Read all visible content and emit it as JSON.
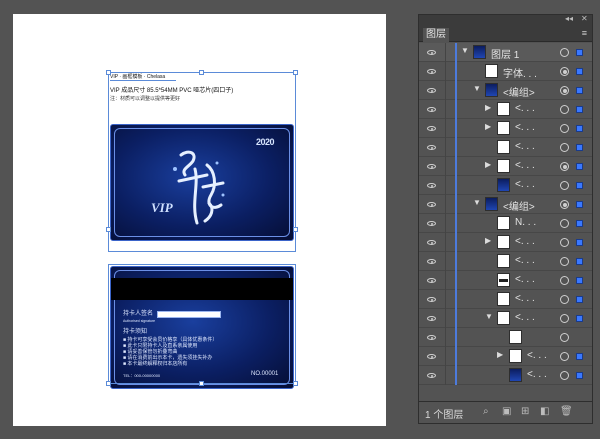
{
  "panel": {
    "tab_label": "图层",
    "collapse_glyph": "◂◂",
    "close_glyph": "✕",
    "menu_glyph": "≡",
    "layer_count": "1 个图层",
    "rows": [
      {
        "level": 0,
        "triangle": "▼",
        "name": "图层 1",
        "thumb": "layer",
        "target": "empty",
        "selected": true
      },
      {
        "level": 2,
        "triangle": "",
        "name": "字体. . .",
        "thumb": "white",
        "target": "filled",
        "selected": true
      },
      {
        "level": 2,
        "triangle": "▼",
        "name": "<编组>",
        "thumb": "dark",
        "target": "filled",
        "selected": true
      },
      {
        "level": 3,
        "triangle": "▶",
        "name": "<. . .",
        "thumb": "white",
        "target": "empty",
        "selected": true
      },
      {
        "level": 3,
        "triangle": "▶",
        "name": "<. . .",
        "thumb": "white",
        "target": "empty",
        "selected": true
      },
      {
        "level": 3,
        "triangle": "",
        "name": "<. . .",
        "thumb": "white",
        "target": "empty",
        "selected": true
      },
      {
        "level": 3,
        "triangle": "▶",
        "name": "<. . .",
        "thumb": "white",
        "target": "filled",
        "selected": true
      },
      {
        "level": 3,
        "triangle": "",
        "name": "<. . .",
        "thumb": "dark",
        "target": "empty",
        "selected": true
      },
      {
        "level": 2,
        "triangle": "▼",
        "name": "<编组>",
        "thumb": "dark",
        "target": "filled",
        "selected": true
      },
      {
        "level": 3,
        "triangle": "",
        "name": "N. . .",
        "thumb": "white",
        "target": "empty",
        "selected": true
      },
      {
        "level": 3,
        "triangle": "▶",
        "name": "<. . .",
        "thumb": "white",
        "target": "empty",
        "selected": true
      },
      {
        "level": 3,
        "triangle": "",
        "name": "<. . .",
        "thumb": "white",
        "target": "empty",
        "selected": true
      },
      {
        "level": 3,
        "triangle": "",
        "name": "<. . .",
        "thumb": "bar",
        "target": "empty",
        "selected": true
      },
      {
        "level": 3,
        "triangle": "",
        "name": "<. . .",
        "thumb": "white",
        "target": "empty",
        "selected": true
      },
      {
        "level": 3,
        "triangle": "▼",
        "name": "<. . .",
        "thumb": "white",
        "target": "empty",
        "selected": true
      },
      {
        "level": 4,
        "triangle": "",
        "name": "",
        "thumb": "white",
        "target": "empty",
        "selected": false
      },
      {
        "level": 4,
        "triangle": "▶",
        "name": "<. . .",
        "thumb": "white",
        "target": "empty",
        "selected": true
      },
      {
        "level": 4,
        "triangle": "",
        "name": "<. . .",
        "thumb": "dark",
        "target": "empty",
        "selected": true
      }
    ]
  },
  "artboard": {
    "header_line1": "VIP · 画框模板 · Chelasa",
    "header_line2": "VIP 成品尺寸 85.5*54MM PVC 哑芯片(四口子)",
    "header_line3": "注：材质可以调整以提供等更好"
  },
  "front_card": {
    "badge": "2020",
    "vip": "VIP"
  },
  "back_card": {
    "holder_label": "持卡人签名",
    "holder_sub": "Authorised signature",
    "notice_title": "持卡须知",
    "notice_lines": [
      "■ 持卡可享受会员价格享（具体优惠条件）",
      "■ 此卡只限持卡人及直系亲属使用",
      "■ 请妥善保管勿折叠弯曲",
      "■ 请在消费前出示本卡，遗失须挂失补办",
      "■ 本卡最终解释权归本店所有"
    ],
    "tel": "TEL：000-00000000",
    "card_no": "NO.00001"
  }
}
